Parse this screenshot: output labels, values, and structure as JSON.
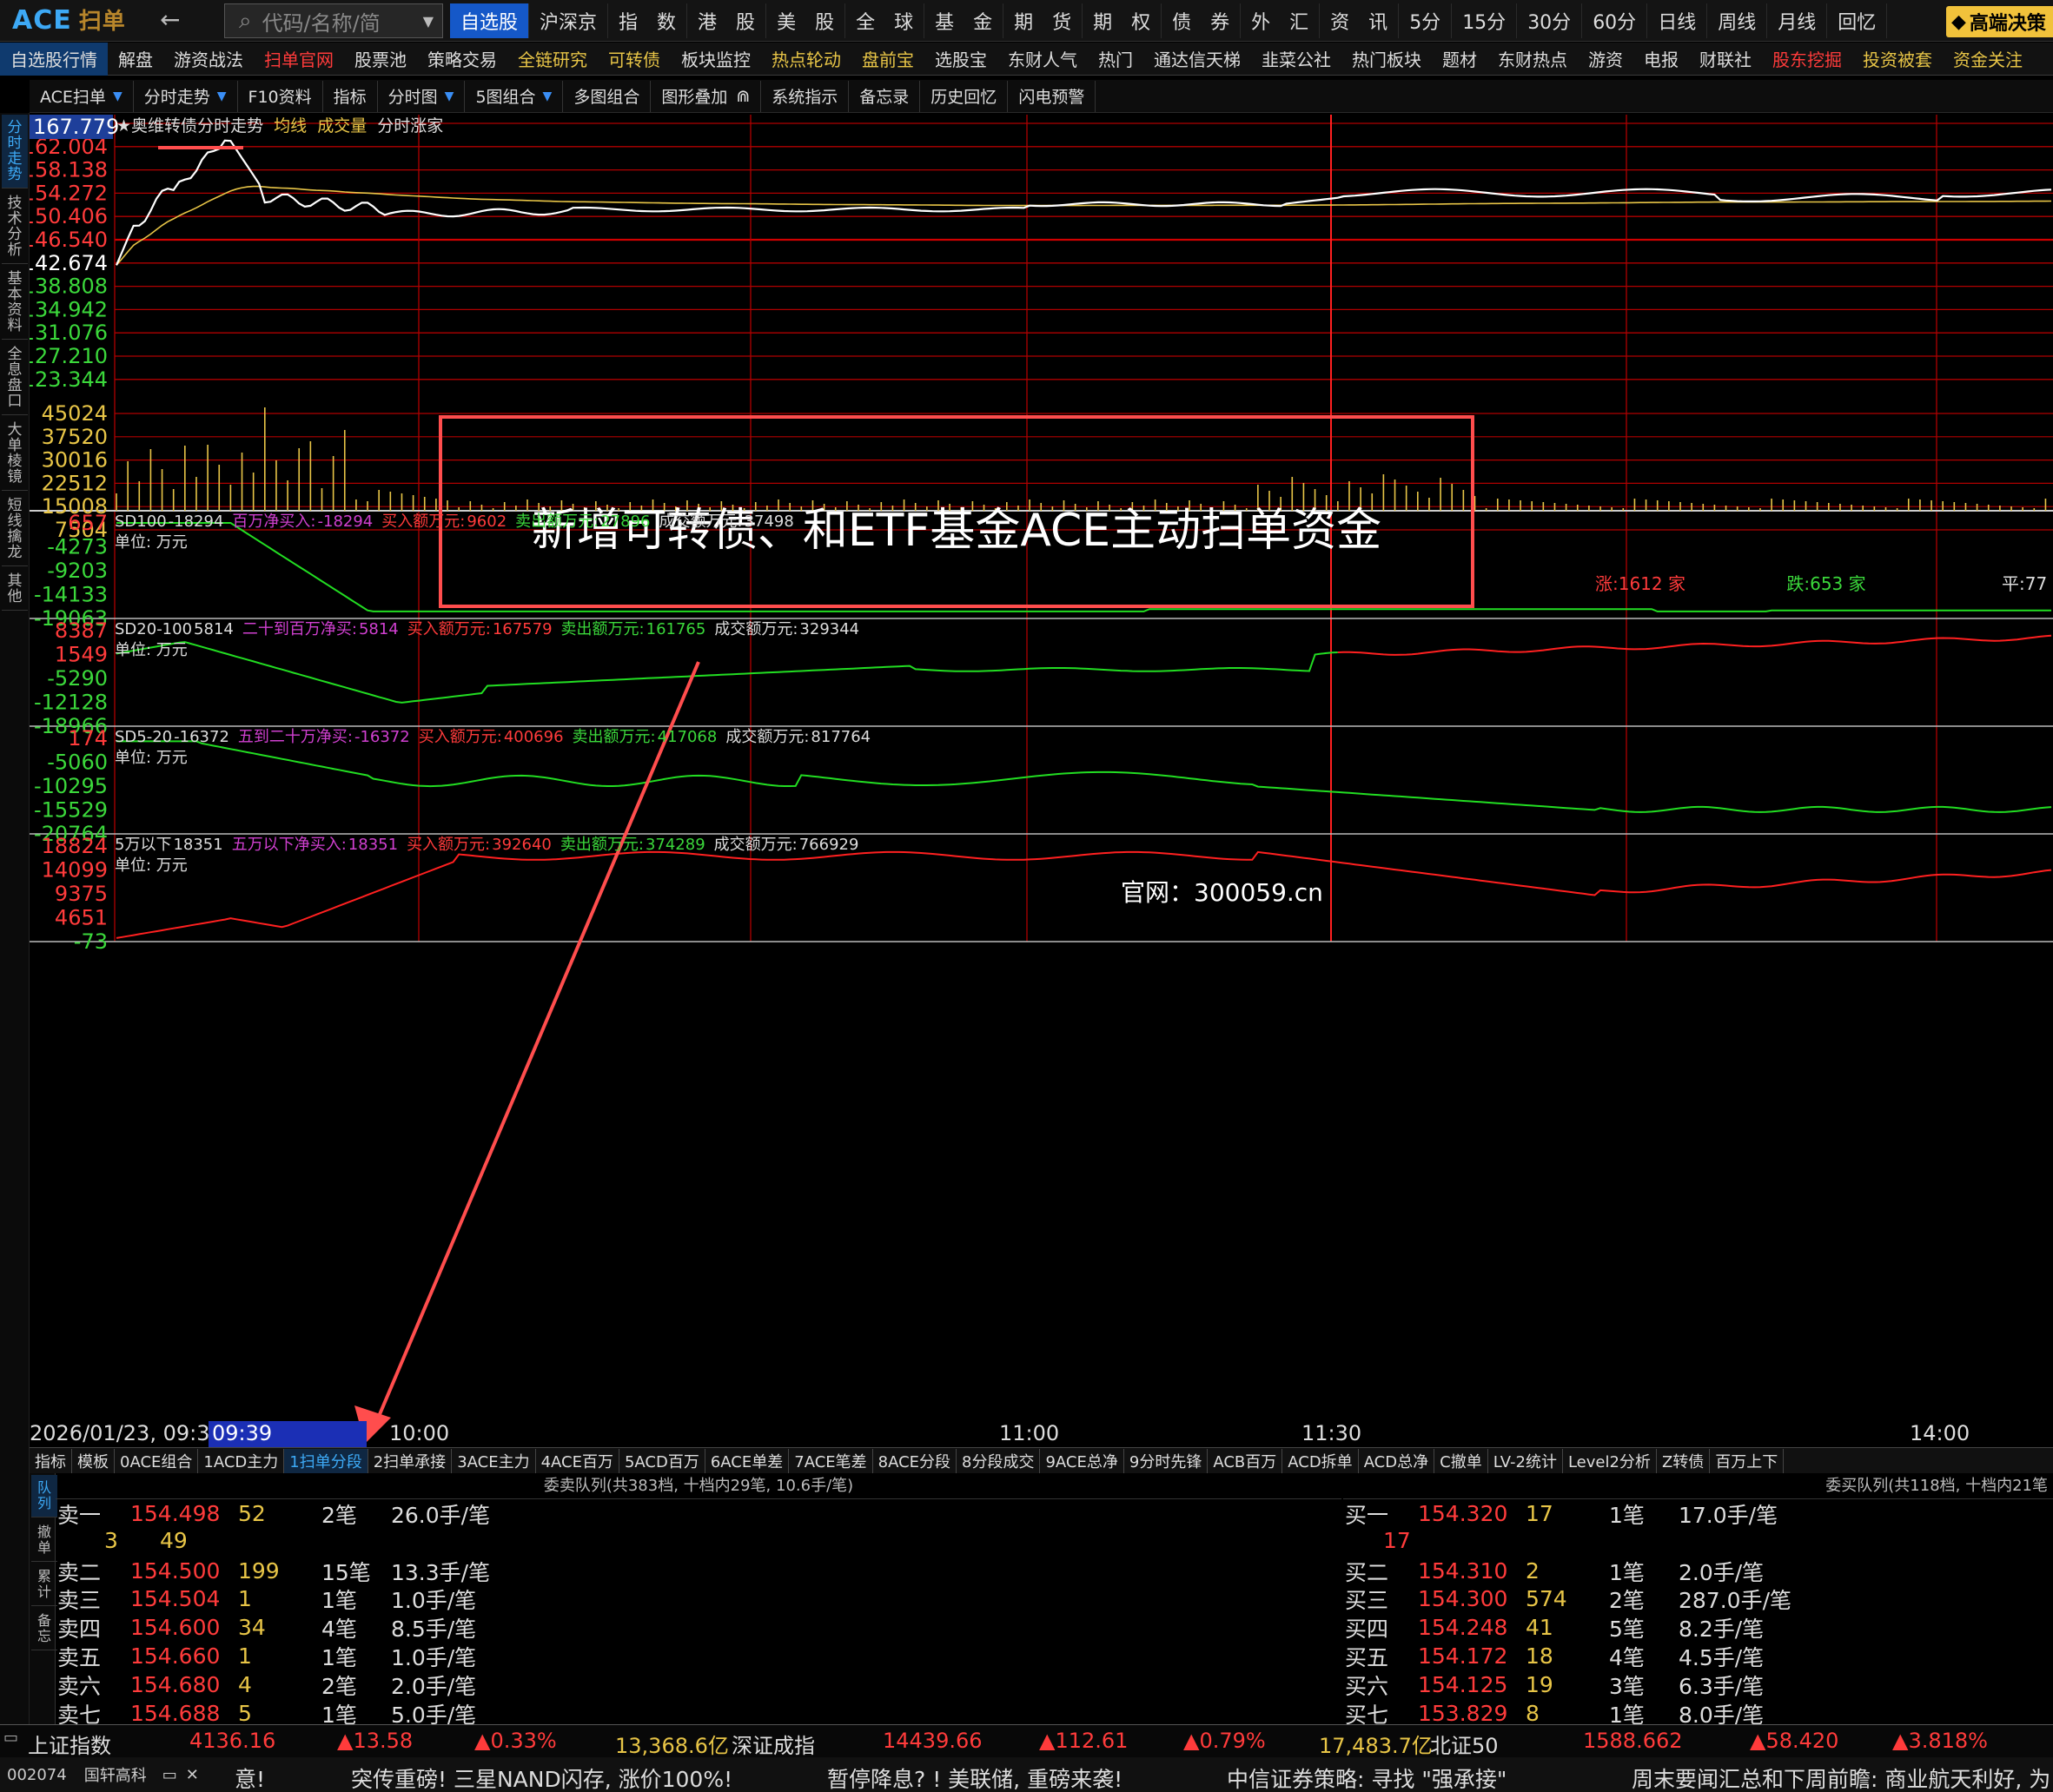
{
  "topbar": {
    "logo": "ACE",
    "logo_sub": "扫单",
    "search_placeholder": "代码/名称/简",
    "nav": [
      "自选股",
      "沪深京",
      "指　数",
      "港　股",
      "美　股",
      "全　球",
      "基　金",
      "期　货",
      "期　权",
      "债　券",
      "外　汇",
      "资　讯",
      "5分",
      "15分",
      "30分",
      "60分",
      "日线",
      "周线",
      "月线",
      "回忆"
    ],
    "active_nav": 0,
    "vip": "高端决策"
  },
  "navbar": {
    "items": [
      "自选股行情",
      "解盘",
      "游资战法",
      "扫单官网",
      "股票池",
      "策略交易",
      "全链研究",
      "可转债",
      "板块监控",
      "热点轮动",
      "盘前宝",
      "选股宝",
      "东财人气",
      "热门",
      "通达信天梯",
      "韭菜公社",
      "热门板块",
      "题材",
      "东财热点",
      "游资",
      "电报",
      "财联社",
      "股东挖掘",
      "投资被套",
      "资金关注"
    ]
  },
  "toolbar": {
    "items": [
      "ACE扫单",
      "分时走势",
      "F10资料",
      "指标",
      "分时图",
      "5图组合",
      "多图组合",
      "图形叠加",
      "系统指示",
      "备忘录",
      "历史回忆",
      "闪电预警"
    ]
  },
  "side_tabs": [
    "分时走势",
    "技术分析",
    "基本资料",
    "全息盘口",
    "大单棱镜",
    "短线擒龙",
    "其他"
  ],
  "chart": {
    "title_star": "★",
    "title_name": "奥维转债",
    "title_mode": "分时走势",
    "legend_avg": "均线",
    "legend_vol": "成交量",
    "legend_rank": "分时涨家",
    "last_price": "167.779",
    "price_ticks": [
      "162.004",
      "158.138",
      "154.272",
      "150.406",
      "146.540",
      "142.674",
      "138.808",
      "134.942",
      "131.076",
      "127.210",
      "123.344"
    ],
    "vol_ticks": [
      "45024",
      "37520",
      "30016",
      "22512",
      "15008",
      "7504"
    ],
    "up_count": "涨:1612 家",
    "down_count": "跌:653 家",
    "flat_count": "平:77",
    "annotation": "新增可转债、和ETF基金ACE主动扫单资金",
    "site": "官网：300059.cn"
  },
  "indicators": [
    {
      "name": "SD100",
      "value": "-18294",
      "label": "百万净买入:",
      "net": "-18294",
      "buy_label": "买入额万元:",
      "buy": "9602",
      "sell_label": "卖出额万元:",
      "sell": "27896",
      "total_label": "成交额万元:",
      "total": "37498",
      "unit": "单位: 万元",
      "ticks": [
        "657",
        "-4273",
        "-9203",
        "-14133",
        "-19063"
      ]
    },
    {
      "name": "SD20-100",
      "value": "5814",
      "label": "二十到百万净买:",
      "net": "5814",
      "buy_label": "买入额万元:",
      "buy": "167579",
      "sell_label": "卖出额万元:",
      "sell": "161765",
      "total_label": "成交额万元:",
      "total": "329344",
      "unit": "单位: 万元",
      "ticks": [
        "8387",
        "1549",
        "-5290",
        "-12128",
        "-18966"
      ]
    },
    {
      "name": "SD5-20",
      "value": "-16372",
      "label": "五到二十万净买:",
      "net": "-16372",
      "buy_label": "买入额万元:",
      "buy": "400696",
      "sell_label": "卖出额万元:",
      "sell": "417068",
      "total_label": "成交额万元:",
      "total": "817764",
      "unit": "单位: 万元",
      "ticks": [
        "174",
        "-5060",
        "-10295",
        "-15529",
        "-20764"
      ]
    },
    {
      "name": "5万以下",
      "value": "18351",
      "label": "五万以下净买入:",
      "net": "18351",
      "buy_label": "买入额万元:",
      "buy": "392640",
      "sell_label": "卖出额万元:",
      "sell": "374289",
      "total_label": "成交额万元:",
      "total": "766929",
      "unit": "单位: 万元",
      "ticks": [
        "18824",
        "14099",
        "9375",
        "4651",
        "-73"
      ]
    }
  ],
  "time_axis": {
    "start": "2026/01/23, 09:30",
    "cursor": "09:39",
    "marks": [
      "10:00",
      "11:00",
      "11:30",
      "14:00"
    ]
  },
  "bottom_tabs": [
    "指标",
    "模板",
    "0ACE组合",
    "1ACD主力",
    "1扫单分段",
    "2扫单承接",
    "3ACE主力",
    "4ACE百万",
    "5ACD百万",
    "6ACE单差",
    "7ACE笔差",
    "8ACE分段",
    "8分段成交",
    "9ACE总净",
    "9分时先锋",
    "ACB百万",
    "ACD拆单",
    "ACD总净",
    "C撤单",
    "LV-2统计",
    "Level2分析",
    "Z转债",
    "百万上下"
  ],
  "bottom_active": 4,
  "queue": {
    "left_tabs": [
      "队列",
      "撤单",
      "累计",
      "备忘"
    ],
    "sell_title": "委卖队列(共383档, 十档内29笔, 10.6手/笔)",
    "buy_title": "委买队列(共118档, 十档内21笔",
    "sell_extra": [
      "3",
      "49"
    ],
    "buy_extra": "17",
    "sells": [
      {
        "label": "卖一",
        "price": "154.498",
        "vol": "52",
        "cnt": "2笔",
        "avg": "26.0手/笔"
      },
      {
        "label": "卖二",
        "price": "154.500",
        "vol": "199",
        "cnt": "15笔",
        "avg": "13.3手/笔"
      },
      {
        "label": "卖三",
        "price": "154.504",
        "vol": "1",
        "cnt": "1笔",
        "avg": "1.0手/笔"
      },
      {
        "label": "卖四",
        "price": "154.600",
        "vol": "34",
        "cnt": "4笔",
        "avg": "8.5手/笔"
      },
      {
        "label": "卖五",
        "price": "154.660",
        "vol": "1",
        "cnt": "1笔",
        "avg": "1.0手/笔"
      },
      {
        "label": "卖六",
        "price": "154.680",
        "vol": "4",
        "cnt": "2笔",
        "avg": "2.0手/笔"
      },
      {
        "label": "卖七",
        "price": "154.688",
        "vol": "5",
        "cnt": "1笔",
        "avg": "5.0手/笔"
      }
    ],
    "buys": [
      {
        "label": "买一",
        "price": "154.320",
        "vol": "17",
        "cnt": "1笔",
        "avg": "17.0手/笔"
      },
      {
        "label": "买二",
        "price": "154.310",
        "vol": "2",
        "cnt": "1笔",
        "avg": "2.0手/笔"
      },
      {
        "label": "买三",
        "price": "154.300",
        "vol": "574",
        "cnt": "2笔",
        "avg": "287.0手/笔"
      },
      {
        "label": "买四",
        "price": "154.248",
        "vol": "41",
        "cnt": "5笔",
        "avg": "8.2手/笔"
      },
      {
        "label": "买五",
        "price": "154.172",
        "vol": "18",
        "cnt": "4笔",
        "avg": "4.5手/笔"
      },
      {
        "label": "买六",
        "price": "154.125",
        "vol": "19",
        "cnt": "3笔",
        "avg": "6.3手/笔"
      },
      {
        "label": "买七",
        "price": "153.829",
        "vol": "8",
        "cnt": "1笔",
        "avg": "8.0手/笔"
      }
    ]
  },
  "index_bar": {
    "sh_name": "上证指数",
    "sh_val": "4136.16",
    "sh_chg": "▲13.58",
    "sh_pct": "▲0.33%",
    "sh_amt": "13,368.6亿",
    "sz_name": "深证成指",
    "sz_val": "14439.66",
    "sz_chg": "▲112.61",
    "sz_pct": "▲0.79%",
    "sz_amt": "17,483.7亿",
    "bz_name": "北证50",
    "bz_val": "1588.662",
    "bz_chg": "▲58.420",
    "bz_pct": "▲3.818%"
  },
  "news": {
    "stock_code": "002074",
    "stock_name": "国轩高科",
    "items": [
      "意!",
      "突传重磅! 三星NAND闪存, 涨价100%!",
      "暂停降息? ! 美联储, 重磅来袭!",
      "中信证券策略: 寻找 \"强承接\"",
      "周末要闻汇总和下周前瞻: 商业航天利好, 为"
    ]
  },
  "colors": {
    "up": "#ff3b3b",
    "down": "#3bd83b",
    "avg": "#e8c547",
    "price": "#ffffff",
    "grid": "#b00000",
    "accent": "#1558c8"
  }
}
